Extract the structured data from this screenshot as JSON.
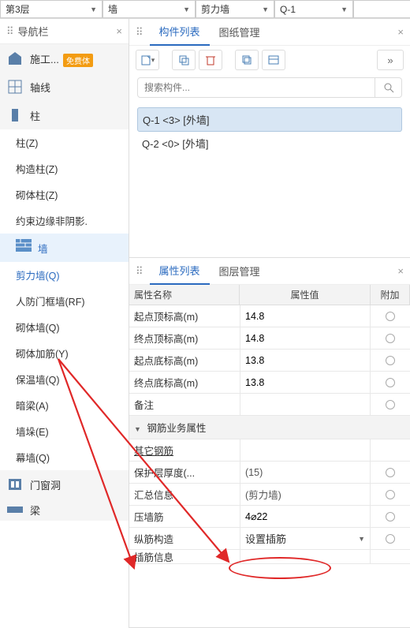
{
  "topbar": {
    "floor": "第3层",
    "cat": "墙",
    "type": "剪力墙",
    "inst": "Q-1"
  },
  "sidebar": {
    "title": "导航栏",
    "badge": "免费体",
    "cats": [
      {
        "ico": "shigong",
        "label": "施工..."
      },
      {
        "ico": "grid",
        "label": "轴线"
      },
      {
        "ico": "column",
        "label": "柱"
      }
    ],
    "col_subs": [
      "柱(Z)",
      "构造柱(Z)",
      "砌体柱(Z)",
      "约束边缘非阴影."
    ],
    "wall_cat": "墙",
    "wall_subs": [
      {
        "label": "剪力墙(Q)",
        "blue": true
      },
      {
        "label": "人防门框墙(RF)"
      },
      {
        "label": "砌体墙(Q)"
      },
      {
        "label": "砌体加筋(Y)"
      },
      {
        "label": "保温墙(Q)"
      },
      {
        "label": "暗梁(A)"
      },
      {
        "label": "墙垛(E)"
      },
      {
        "label": "幕墙(Q)"
      }
    ],
    "door_cat": "门窗洞",
    "beam_cat": "梁"
  },
  "compPanel": {
    "tab1": "构件列表",
    "tab2": "图纸管理",
    "search_ph": "搜索构件...",
    "items": [
      {
        "text": "Q-1 <3> [外墙]",
        "selected": true
      },
      {
        "text": "Q-2 <0> [外墙]",
        "selected": false
      }
    ]
  },
  "propPanel": {
    "tab1": "属性列表",
    "tab2": "图层管理",
    "hdr_name": "属性名称",
    "hdr_val": "属性值",
    "hdr_add": "附加",
    "rows": [
      {
        "name": "起点顶标高(m)",
        "val": "14.8",
        "radio": true
      },
      {
        "name": "终点顶标高(m)",
        "val": "14.8",
        "radio": true
      },
      {
        "name": "起点底标高(m)",
        "val": "13.8",
        "radio": true
      },
      {
        "name": "终点底标高(m)",
        "val": "13.8",
        "radio": true
      },
      {
        "name": "备注",
        "val": "",
        "radio": true
      }
    ],
    "group1": "钢筋业务属性",
    "rows2": [
      {
        "name": "其它钢筋",
        "val": "",
        "link": true
      },
      {
        "name": "保护层厚度(...",
        "val": "(15)",
        "radio": true
      },
      {
        "name": "汇总信息",
        "val": "(剪力墙)",
        "radio": true
      },
      {
        "name": "压墙筋",
        "val": "4⌀22",
        "radio": true,
        "circled": true
      },
      {
        "name": "纵筋构造",
        "val": "设置插筋",
        "select": true,
        "radio": true
      },
      {
        "name": "插筋信息",
        "val": "",
        "radio": false
      }
    ]
  }
}
